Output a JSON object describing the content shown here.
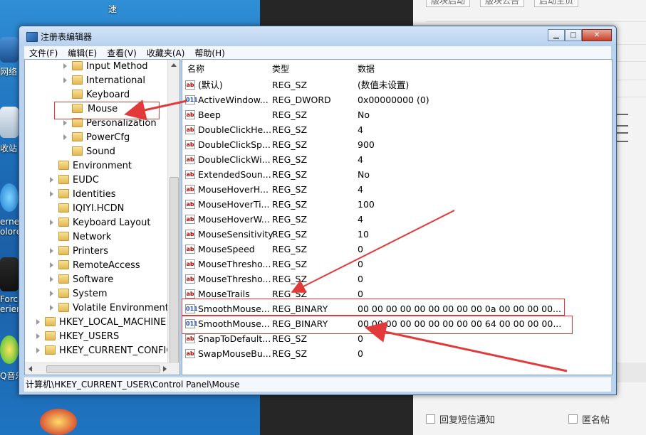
{
  "desktop": {
    "top_label": "速",
    "icons": [
      {
        "name": "network",
        "label": "网络"
      },
      {
        "name": "recycle-bin",
        "label": "收站"
      },
      {
        "name": "ie",
        "label": "erne\nolore"
      },
      {
        "name": "nvidia",
        "label": "Forc\nerien"
      },
      {
        "name": "music",
        "label": "Q音乐"
      }
    ]
  },
  "right_app": {
    "top_buttons": [
      "版块启动",
      "版块公告",
      "启动主页"
    ],
    "checkbox1": "回复短信通知",
    "checkbox2": "匿名帖"
  },
  "window": {
    "title": "注册表编辑器",
    "buttons": {
      "min": "▁",
      "max": "□",
      "close": "✕"
    }
  },
  "menu": [
    "文件(F)",
    "编辑(E)",
    "查看(V)",
    "收藏夹(A)",
    "帮助(H)"
  ],
  "tree": [
    {
      "label": "Input Method",
      "expander": true,
      "level": 2
    },
    {
      "label": "International",
      "expander": true,
      "level": 2
    },
    {
      "label": "Keyboard",
      "expander": false,
      "level": 2
    },
    {
      "label": "Mouse",
      "expander": false,
      "level": 2,
      "selected": true
    },
    {
      "label": "Personalization",
      "expander": true,
      "level": 2
    },
    {
      "label": "PowerCfg",
      "expander": true,
      "level": 2
    },
    {
      "label": "Sound",
      "expander": false,
      "level": 2
    },
    {
      "label": "Environment",
      "expander": false,
      "level": 1
    },
    {
      "label": "EUDC",
      "expander": true,
      "level": 1
    },
    {
      "label": "Identities",
      "expander": true,
      "level": 1
    },
    {
      "label": "IQIYI.HCDN",
      "expander": false,
      "level": 1
    },
    {
      "label": "Keyboard Layout",
      "expander": true,
      "level": 1
    },
    {
      "label": "Network",
      "expander": false,
      "level": 1
    },
    {
      "label": "Printers",
      "expander": true,
      "level": 1
    },
    {
      "label": "RemoteAccess",
      "expander": true,
      "level": 1
    },
    {
      "label": "Software",
      "expander": true,
      "level": 1
    },
    {
      "label": "System",
      "expander": true,
      "level": 1
    },
    {
      "label": "Volatile Environment",
      "expander": true,
      "level": 1
    },
    {
      "label": "HKEY_LOCAL_MACHINE",
      "expander": true,
      "level": 0
    },
    {
      "label": "HKEY_USERS",
      "expander": true,
      "level": 0
    },
    {
      "label": "HKEY_CURRENT_CONFIG",
      "expander": true,
      "level": 0
    }
  ],
  "columns": {
    "name": "名称",
    "type": "类型",
    "data": "数据"
  },
  "values": [
    {
      "name": "(默认)",
      "type": "REG_SZ",
      "data": "(数值未设置)",
      "kind": "sz"
    },
    {
      "name": "ActiveWindow...",
      "type": "REG_DWORD",
      "data": "0x00000000 (0)",
      "kind": "bin"
    },
    {
      "name": "Beep",
      "type": "REG_SZ",
      "data": "No",
      "kind": "sz"
    },
    {
      "name": "DoubleClickHe...",
      "type": "REG_SZ",
      "data": "4",
      "kind": "sz"
    },
    {
      "name": "DoubleClickSp...",
      "type": "REG_SZ",
      "data": "900",
      "kind": "sz"
    },
    {
      "name": "DoubleClickWi...",
      "type": "REG_SZ",
      "data": "4",
      "kind": "sz"
    },
    {
      "name": "ExtendedSoun...",
      "type": "REG_SZ",
      "data": "No",
      "kind": "sz"
    },
    {
      "name": "MouseHoverH...",
      "type": "REG_SZ",
      "data": "4",
      "kind": "sz"
    },
    {
      "name": "MouseHoverTi...",
      "type": "REG_SZ",
      "data": "100",
      "kind": "sz"
    },
    {
      "name": "MouseHoverW...",
      "type": "REG_SZ",
      "data": "4",
      "kind": "sz"
    },
    {
      "name": "MouseSensitivity",
      "type": "REG_SZ",
      "data": "10",
      "kind": "sz"
    },
    {
      "name": "MouseSpeed",
      "type": "REG_SZ",
      "data": "0",
      "kind": "sz"
    },
    {
      "name": "MouseThresho...",
      "type": "REG_SZ",
      "data": "0",
      "kind": "sz"
    },
    {
      "name": "MouseThresho...",
      "type": "REG_SZ",
      "data": "0",
      "kind": "sz"
    },
    {
      "name": "MouseTrails",
      "type": "REG_SZ",
      "data": "0",
      "kind": "sz"
    },
    {
      "name": "SmoothMouse...",
      "type": "REG_BINARY",
      "data": "00 00 00 00 00 00 00 00 00 0a 00 00 00 00...",
      "kind": "bin"
    },
    {
      "name": "SmoothMouse...",
      "type": "REG_BINARY",
      "data": "00 00 00 00 00 00 00 00 00 64 00 00 00 00...",
      "kind": "bin"
    },
    {
      "name": "SnapToDefault...",
      "type": "REG_SZ",
      "data": "0",
      "kind": "sz"
    },
    {
      "name": "SwapMouseBu...",
      "type": "REG_SZ",
      "data": "0",
      "kind": "sz"
    }
  ],
  "status": "计算机\\HKEY_CURRENT_USER\\Control Panel\\Mouse",
  "colors": {
    "annotation": "#e23a3a",
    "selection_border": "#e23a3a"
  }
}
